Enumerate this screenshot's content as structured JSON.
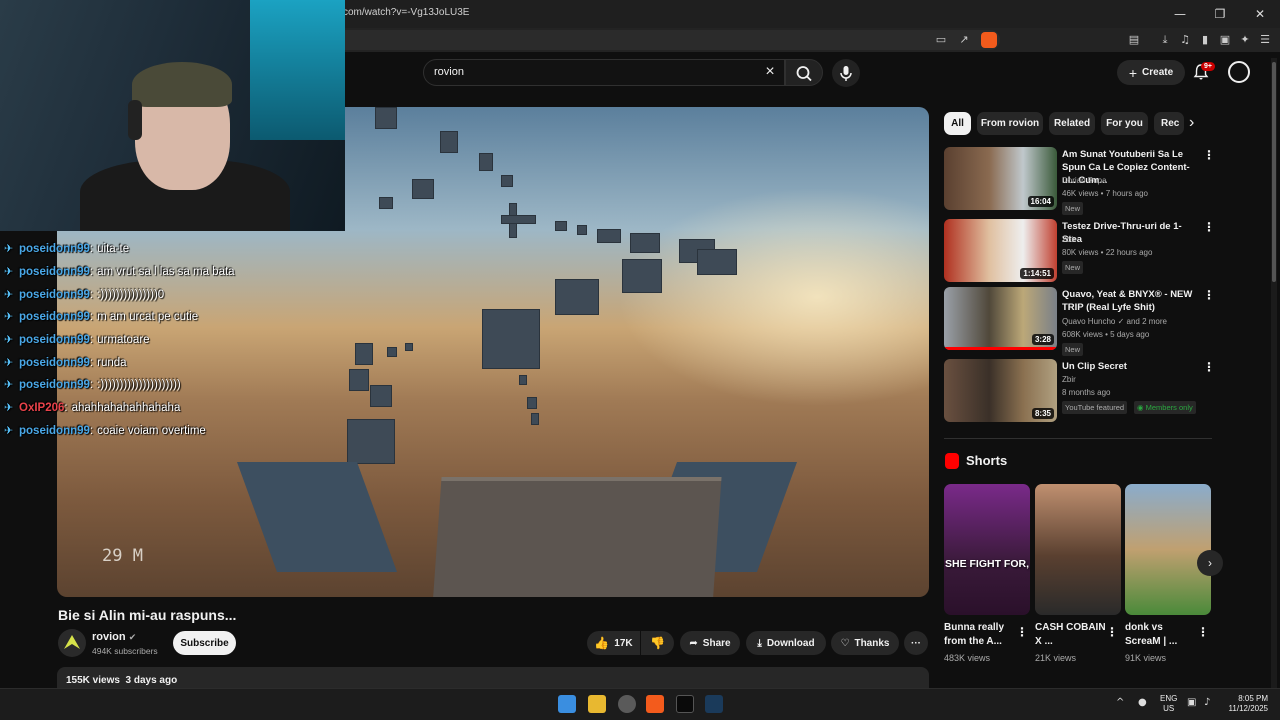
{
  "browser": {
    "url": "com/watch?v=-Vg13JoLU3E",
    "window_controls": [
      "—",
      "❐",
      "✕"
    ]
  },
  "header": {
    "search_value": "rovion",
    "create_label": "Create",
    "notification_count": "9+"
  },
  "player": {
    "overlay_distance": "29 M"
  },
  "chat": [
    {
      "user": "poseidonn99",
      "sep": ":",
      "message": "uita-te",
      "color": "#4aa8e8"
    },
    {
      "user": "poseidonn99",
      "sep": ":",
      "message": "am vrut sa l las sa ma bata",
      "color": "#4aa8e8"
    },
    {
      "user": "poseidonn99",
      "sep": ":",
      "message": ":)))))))))))))))0",
      "color": "#4aa8e8"
    },
    {
      "user": "poseidonn99",
      "sep": ":",
      "message": "m am urcat pe cutie",
      "color": "#4aa8e8"
    },
    {
      "user": "poseidonn99",
      "sep": ":",
      "message": "urmatoare",
      "color": "#4aa8e8"
    },
    {
      "user": "poseidonn99",
      "sep": ":",
      "message": "runda",
      "color": "#4aa8e8"
    },
    {
      "user": "poseidonn99",
      "sep": ":",
      "message": ":)))))))))))))))))))))",
      "color": "#4aa8e8"
    },
    {
      "user": "OxIP206",
      "sep": ":",
      "message": "ahahhahahahhahaha",
      "color": "#e8424a"
    },
    {
      "user": "poseidonn99",
      "sep": ":",
      "message": "coaie voiam overtime",
      "color": "#4aa8e8"
    }
  ],
  "video": {
    "title": "Bie si Alin mi-au raspuns...",
    "channel": "rovion",
    "subscribers": "494K subscribers",
    "subscribe_label": "Subscribe",
    "likes": "17K",
    "share_label": "Share",
    "download_label": "Download",
    "thanks_label": "Thanks",
    "views": "155K views",
    "age": "3 days ago"
  },
  "chips": [
    "All",
    "From rovion",
    "Related",
    "For you",
    "Rec"
  ],
  "recommendations": [
    {
      "title": "Am Sunat Youtuberii Sa Le Spun Ca Le Copiez Content-ul.. Cum...",
      "channel": "Dorian Popa",
      "meta": "46K views • 7 hours ago",
      "badge": "New",
      "duration": "16:04"
    },
    {
      "title": "Testez Drive-Thru-uri de 1-Stea",
      "channel": "Zbir",
      "meta": "80K views • 22 hours ago",
      "badge": "New",
      "duration": "1:14:51"
    },
    {
      "title": "Quavo, Yeat & BNYX® - NEW TRIP (Real Lyfe Shit)",
      "channel": "Quavo Huncho ✓ and 2 more",
      "meta": "608K views • 5 days ago",
      "badge": "New",
      "duration": "3:28"
    },
    {
      "title": "Un Clip Secret",
      "channel": "Zbir",
      "meta": "8 months ago",
      "badge": "YouTube featured",
      "badge2": "Members only",
      "duration": "8:35"
    }
  ],
  "shorts": {
    "heading": "Shorts",
    "items": [
      {
        "title": "Bunna really from the A...",
        "views": "483K views",
        "overlay": "SHE FIGHT FOR,"
      },
      {
        "title": "CASH COBAIN X ...",
        "views": "21K views"
      },
      {
        "title": "donk vs ScreaM | ...",
        "views": "91K views"
      }
    ]
  },
  "taskbar": {
    "lang_top": "ENG",
    "lang_bottom": "US",
    "time": "8:05 PM",
    "date": "11/12/2025"
  },
  "colors": {
    "accent_red": "#ff0000",
    "members_green": "#2ba640"
  }
}
